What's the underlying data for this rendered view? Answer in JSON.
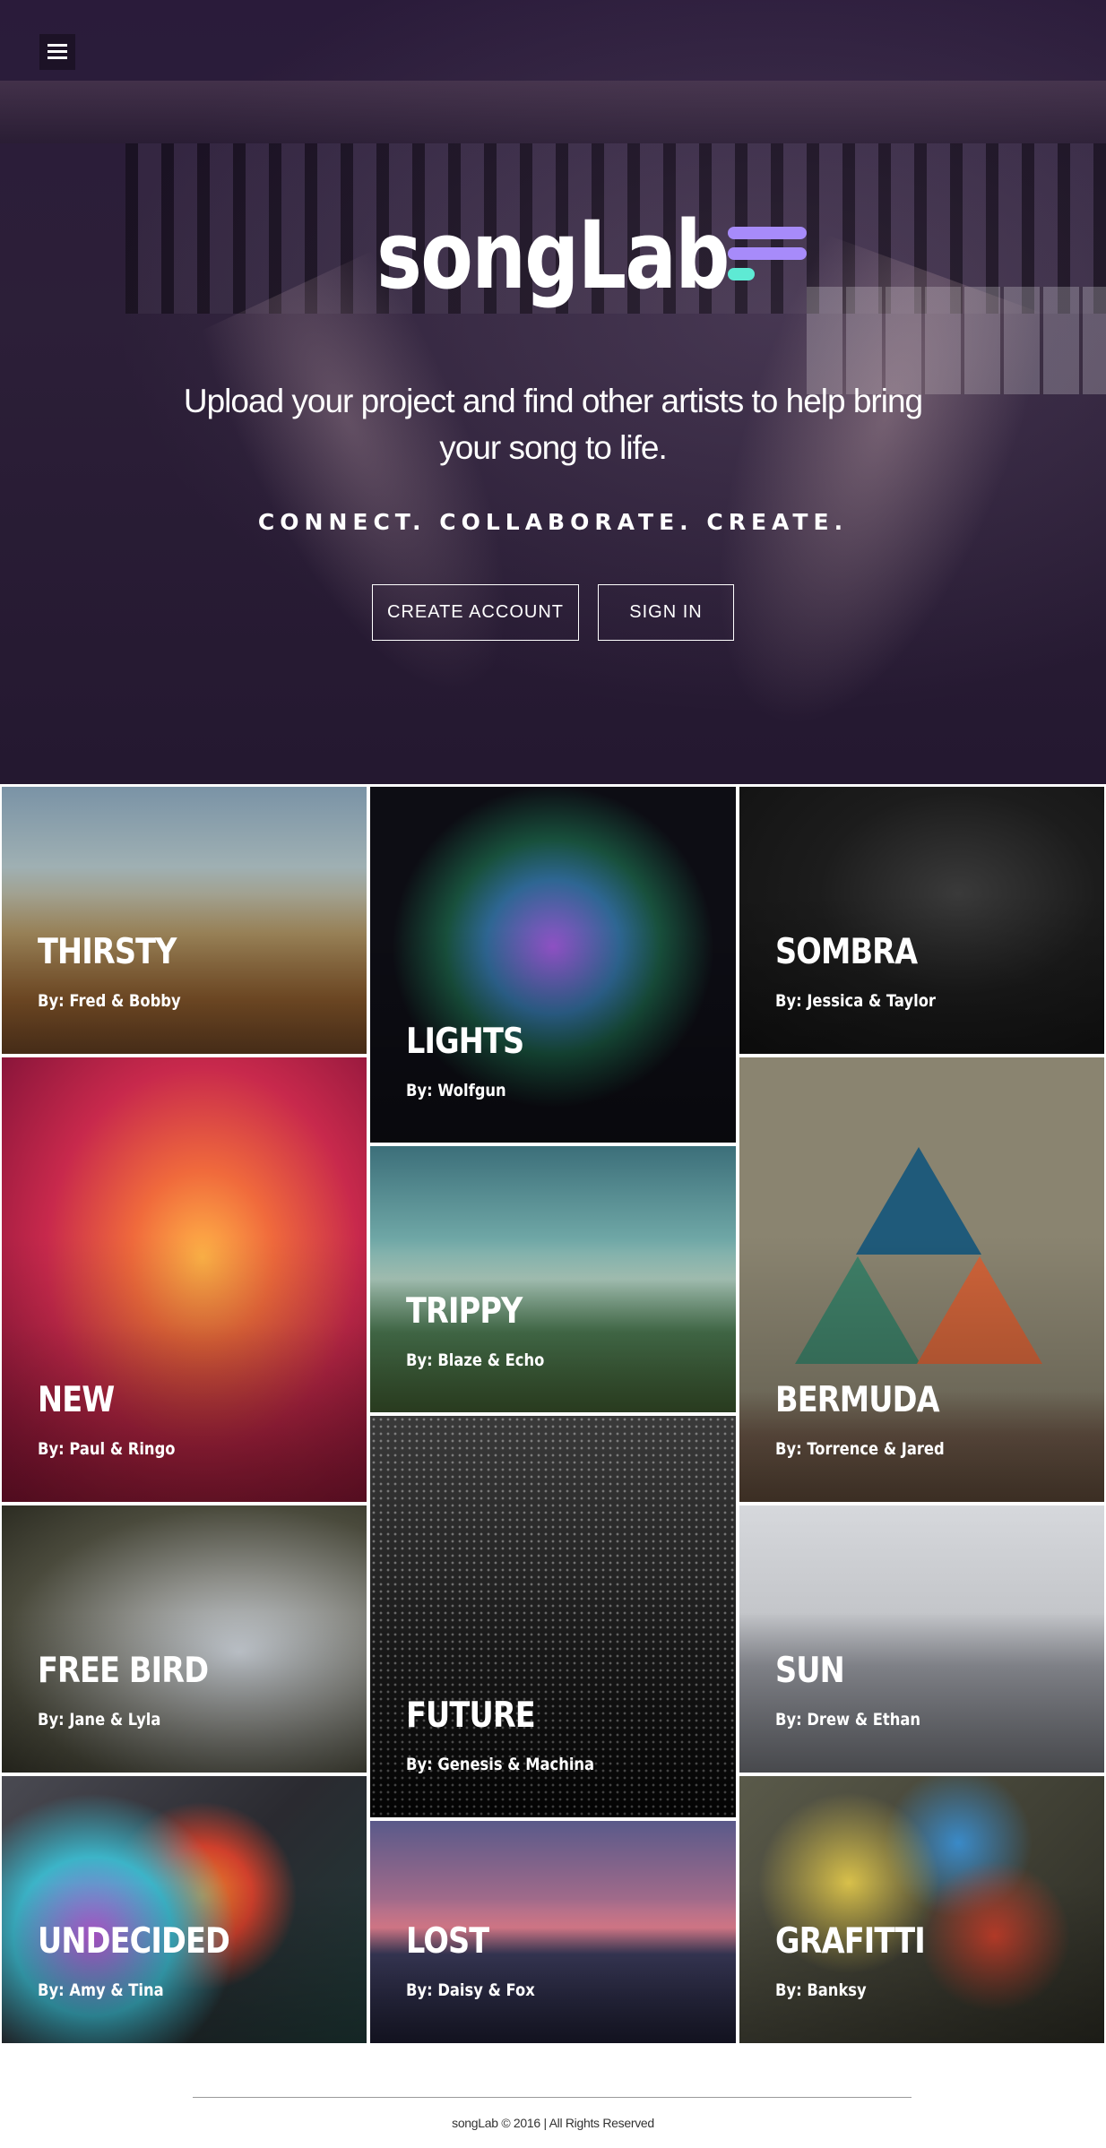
{
  "header": {
    "menu_icon": "hamburger-menu-icon",
    "logo_text": "songLab",
    "tagline": "Upload your project and find other artists to help bring your song to life.",
    "motto": "CONNECT. COLLABORATE. CREATE.",
    "create_account_label": "CREATE ACCOUNT",
    "sign_in_label": "SIGN IN"
  },
  "colors": {
    "hero_overlay": "#2a1b3a",
    "logo_accent_purple": "#a78bfa",
    "logo_accent_teal": "#5eead4"
  },
  "projects": [
    {
      "title": "THIRSTY",
      "artists": "By: Fred & Bobby"
    },
    {
      "title": "LIGHTS",
      "artists": "By: Wolfgun"
    },
    {
      "title": "SOMBRA",
      "artists": "By: Jessica & Taylor"
    },
    {
      "title": "NEW",
      "artists": "By: Paul & Ringo"
    },
    {
      "title": "TRIPPY",
      "artists": "By: Blaze & Echo"
    },
    {
      "title": "BERMUDA",
      "artists": "By: Torrence & Jared"
    },
    {
      "title": "FREE BIRD",
      "artists": "By: Jane & Lyla"
    },
    {
      "title": "FUTURE",
      "artists": "By: Genesis & Machina"
    },
    {
      "title": "SUN",
      "artists": "By: Drew & Ethan"
    },
    {
      "title": "UNDECIDED",
      "artists": "By: Amy & Tina"
    },
    {
      "title": "LOST",
      "artists": "By: Daisy & Fox"
    },
    {
      "title": "GRAFITTI",
      "artists": "By: Banksy"
    }
  ],
  "footer": {
    "copyright": "songLab © 2016 | All Rights Reserved"
  }
}
